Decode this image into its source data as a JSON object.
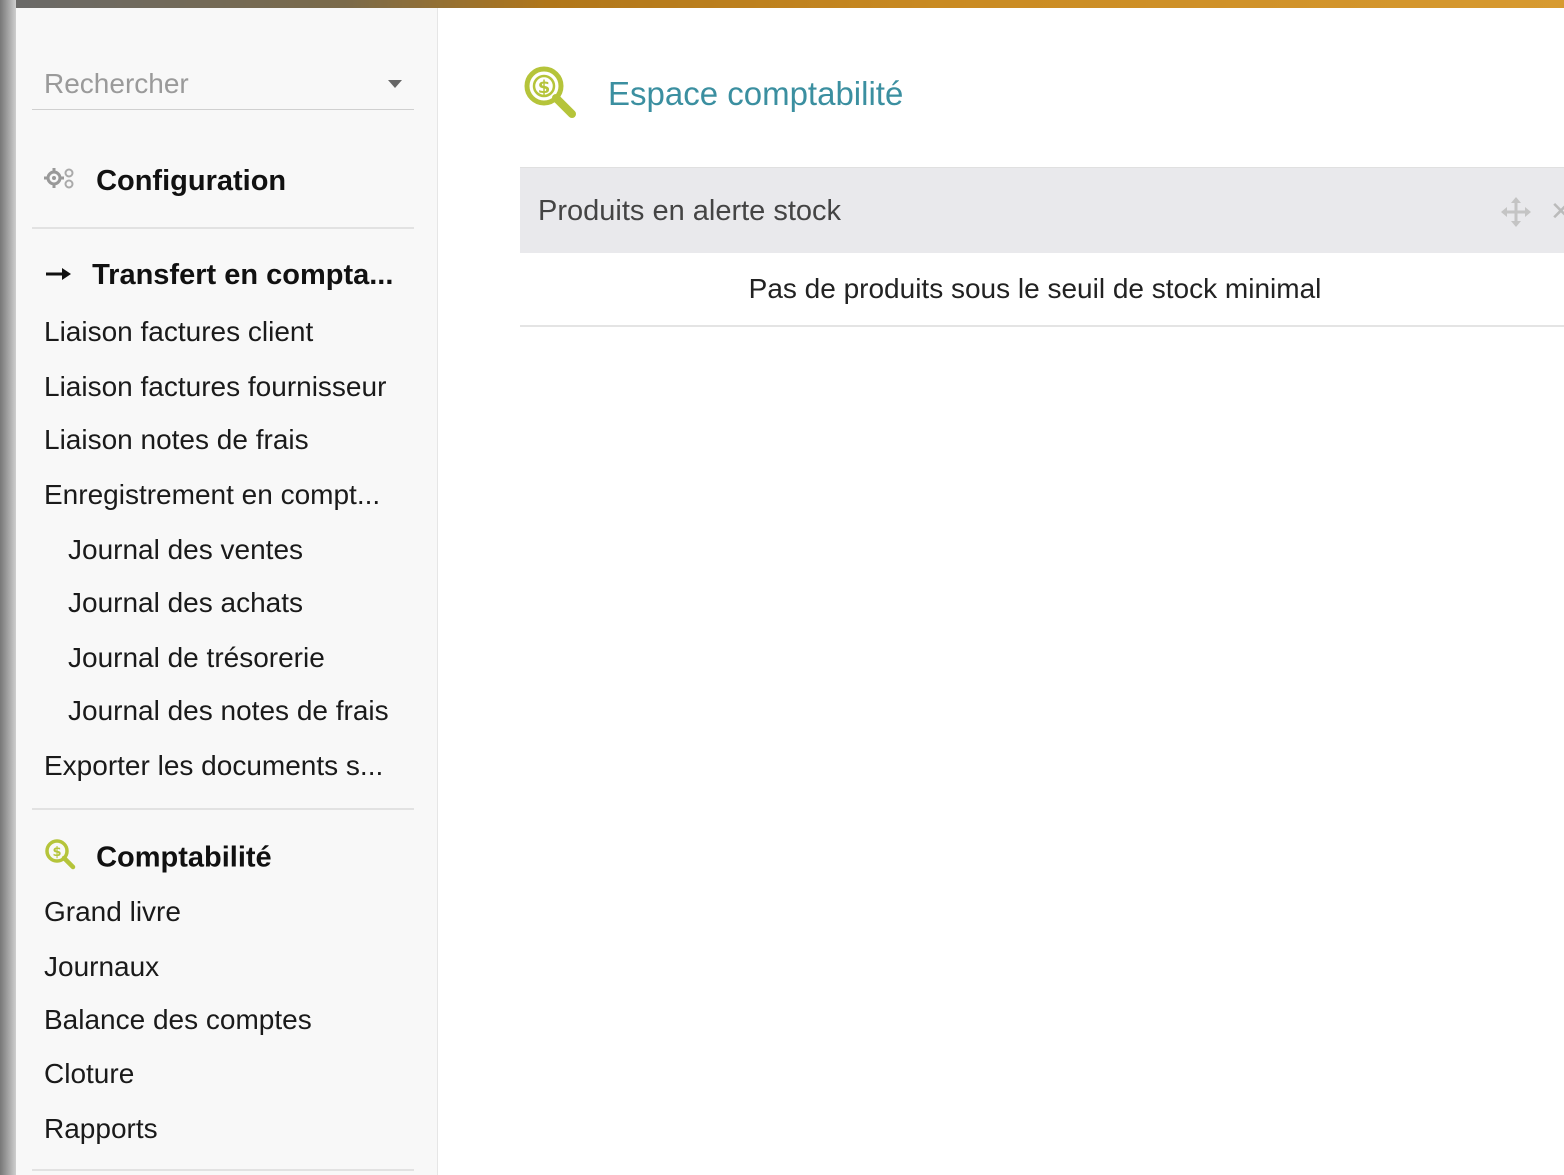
{
  "sidebar": {
    "search": {
      "placeholder": "Rechercher"
    },
    "sections": {
      "configuration": {
        "title": "Configuration",
        "icon": "gears-icon"
      },
      "transfert": {
        "title": "Transfert en compta...",
        "icon": "arrow-right-icon",
        "items": [
          "Liaison factures client",
          "Liaison factures fournisseur",
          "Liaison notes de frais",
          "Enregistrement en compt...",
          "Journal des ventes",
          "Journal des achats",
          "Journal de trésorerie",
          "Journal des notes de frais",
          "Exporter les documents s..."
        ]
      },
      "comptabilite": {
        "title": "Comptabilité",
        "icon": "accounting-magnifier-icon",
        "items": [
          "Grand livre",
          "Journaux",
          "Balance des comptes",
          "Cloture",
          "Rapports"
        ]
      }
    }
  },
  "main": {
    "title": "Espace comptabilité",
    "title_icon": "accounting-magnifier-icon",
    "widget": {
      "title": "Produits en alerte stock",
      "empty_message": "Pas de produits sous le seuil de stock minimal",
      "move_icon": "move-icon",
      "close_icon": "close-icon"
    }
  },
  "colors": {
    "accent_title": "#3b8fa0",
    "accounting_icon": "#b5c43a",
    "sidebar_bg": "#f8f8f8",
    "widget_header_bg": "#e9e9ec"
  }
}
